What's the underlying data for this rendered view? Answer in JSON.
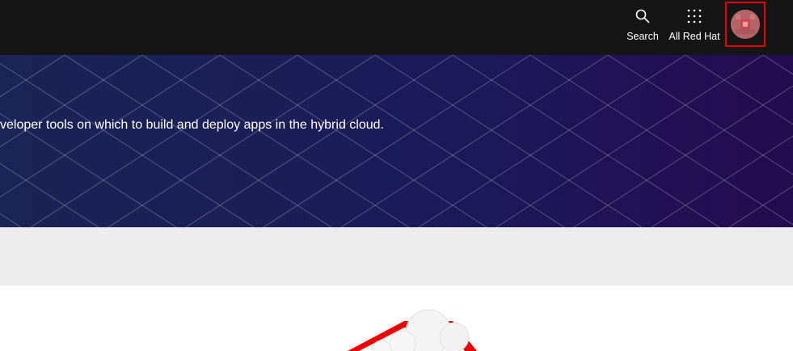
{
  "header": {
    "search_label": "Search",
    "all_red_hat_label": "All Red Hat",
    "accent_color": "#ee0000"
  },
  "hero": {
    "text": "veloper tools on which to build and deploy apps in the hybrid cloud."
  },
  "icons": {
    "search": "search-icon",
    "grid": "grid-icon",
    "avatar": "user-avatar",
    "illustration": "cloud-illustration"
  }
}
